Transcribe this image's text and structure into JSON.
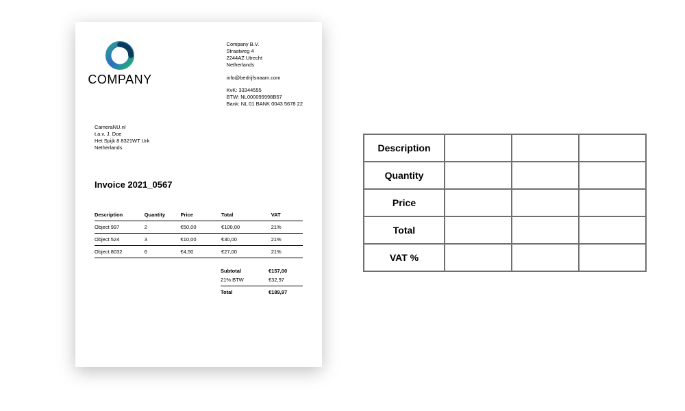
{
  "logo": {
    "text": "COMPANY"
  },
  "company": {
    "name": "Company B.V.",
    "street": "Straatweg 4",
    "postal": "2244AZ Utrecht",
    "country": "Netherlands",
    "email": "info@bedrijfsnaam.com",
    "kvk": "KvK: 33344555",
    "btw": "BTW: NL000099998B57",
    "bank": "Bank: NL 01 BANK 0043 5678 22"
  },
  "recipient": {
    "name": "CameraNU.nl",
    "attn": "t.a.v. J. Doe",
    "street": "Het Spijk 8 8321WT Urk",
    "country": "Netherlands"
  },
  "title": "Invoice 2021_0567",
  "columns": {
    "desc": "Description",
    "qty": "Quantity",
    "price": "Price",
    "total": "Total",
    "vat": "VAT"
  },
  "items": [
    {
      "desc": "Object 997",
      "qty": "2",
      "price": "€50,00",
      "total": "€100,00",
      "vat": "21%"
    },
    {
      "desc": "Object 524",
      "qty": "3",
      "price": "€10,00",
      "total": "€30,00",
      "vat": "21%"
    },
    {
      "desc": "Object 8032",
      "qty": "6",
      "price": "€4,50",
      "total": "€27,00",
      "vat": "21%"
    }
  ],
  "totals": {
    "subtotal_label": "Subtotal",
    "subtotal_value": "€157,00",
    "btw_label": "21% BTW",
    "btw_value": "€32,97",
    "total_label": "Total",
    "total_value": "€189,97"
  },
  "schema_table": {
    "rows": [
      "Description",
      "Quantity",
      "Price",
      "Total",
      "VAT %"
    ],
    "cols": 3
  }
}
